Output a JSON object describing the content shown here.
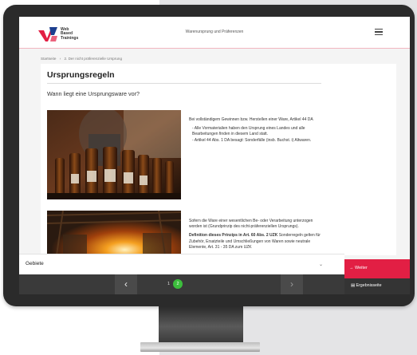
{
  "header": {
    "logo_lines": [
      "Web",
      "Based",
      "Trainings"
    ],
    "title": "Warenursprung und Präferenzen"
  },
  "breadcrumb": {
    "home": "Startseite",
    "separator": "›",
    "current": "2. Der nicht präferenzielle Ursprung"
  },
  "main": {
    "title": "Ursprungsregeln",
    "subtitle": "Wann liegt eine Ursprungsware vor?",
    "block1": {
      "intro": "Bei vollständigem Gewinnen bzw. Herstellen einer Ware, Artikel 44 DA",
      "bullet1": "- Alle Vormaterialien haben den Ursprung eines Landes und alle Bearbeitungen finden in diesem Land statt.",
      "bullet2": "- Artikel 44 Abs. 1 DA besagt: Sonderfälle (insb. Buchst. i) Altwaren."
    },
    "block2": {
      "para1": "Sofern die Ware einer wesentlichen Be- oder Verarbeitung unterzogen worden ist (Grundprinzip des nicht-präferenziellen Ursprungs).",
      "bold": "Definition dieses Prinzips in Art. 60 Abs. 2 UZK",
      "para2": " Sonderregeln gelten für Zubehör, Ersatzteile und Umschließungen von Waren sowie neutrale Elemente, Art. 31 - 35 DA zum UZK"
    }
  },
  "footer": {
    "gebiete_label": "Gebiete",
    "weiter_label": "→ Weiter",
    "prev_page": "1",
    "current_page": "2",
    "ergebnis_label": "Ergebnisseite"
  },
  "colors": {
    "accent_red": "#e21f44",
    "success_green": "#3cbe3c",
    "dark_bar": "#3a3a3a"
  },
  "icons": {
    "menu": "hamburger-icon",
    "dropdown": "chevron-down-icon",
    "prev": "chevron-left-icon",
    "next": "chevron-right-icon",
    "ergebnis": "document-icon"
  }
}
